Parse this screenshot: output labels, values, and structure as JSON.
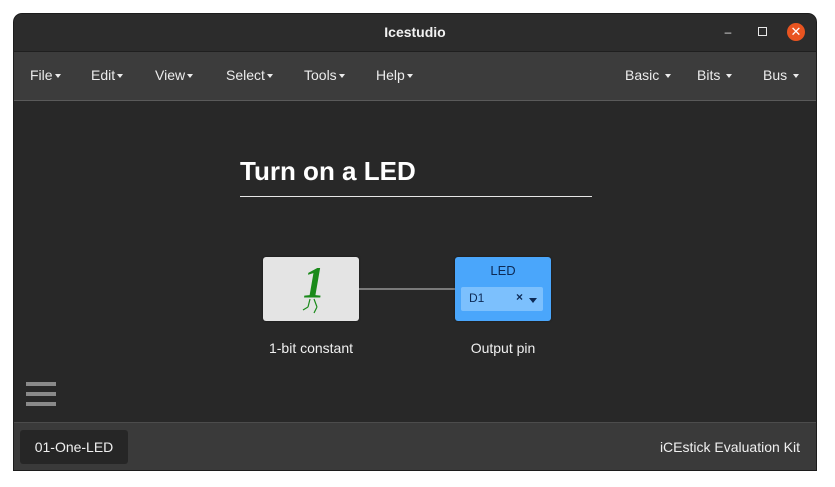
{
  "window": {
    "title": "Icestudio",
    "controls": {
      "minimize": "–",
      "close": "✕"
    }
  },
  "menubar": {
    "left": [
      "File",
      "Edit",
      "View",
      "Select",
      "Tools",
      "Help"
    ],
    "right": [
      "Basic",
      "Bits",
      "Bus"
    ]
  },
  "canvas": {
    "heading": "Turn on a LED",
    "blocks": {
      "constant": {
        "glyph": "1",
        "caption": "1-bit constant",
        "glyph_color": "#1a8a1a"
      },
      "output": {
        "title": "LED",
        "pin": "D1",
        "clear": "×",
        "caption": "Output pin",
        "color": "#4aa6fb"
      }
    }
  },
  "status": {
    "project_tab": "01-One-LED",
    "board": "iCEstick Evaluation Kit"
  },
  "colors": {
    "close_button": "#e95420",
    "background": "#282828"
  }
}
